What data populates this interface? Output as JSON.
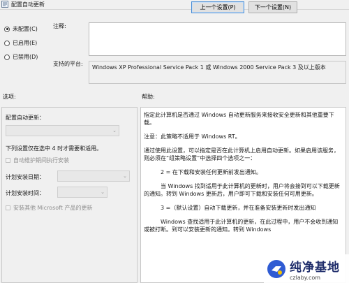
{
  "window": {
    "title": "配置自动更新"
  },
  "nav": {
    "prev": "上一个设置(P)",
    "next": "下一个设置(N)"
  },
  "state": {
    "options": [
      {
        "label": "未配置(C)",
        "checked": true
      },
      {
        "label": "已启用(E)",
        "checked": false
      },
      {
        "label": "已禁用(D)",
        "checked": false
      }
    ]
  },
  "comment": {
    "label": "注释:",
    "value": ""
  },
  "platform": {
    "label": "支持的平台:",
    "value": "Windows XP Professional Service Pack 1 或 Windows 2000 Service Pack 3 及以上版本"
  },
  "options_panel": {
    "heading": "选项:",
    "configure_label": "配置自动更新：",
    "info_text": "下列设置仅在选中 4 时才需要和适用。",
    "maintenance_checkbox": "自动维护期间执行安装",
    "schedule_day_label": "计划安装日期：",
    "schedule_time_label": "计划安装时间：",
    "other_products_checkbox": "安装其他 Microsoft 产品的更新"
  },
  "help_panel": {
    "heading": "帮助:",
    "paragraphs": [
      "指定此计算机是否通过 Windows 自动更新服务来接收安全更新和其他重要下载。",
      "注意：此策略不适用于 Windows RT。",
      "通过使用此设置，可以指定是否在此计算机上启用自动更新。如果启用该服务，则必须在“组策略设置”中选择四个选项之一：",
      "2 = 在下载和安装任何更新前发出通知。",
      "当 Windows 找到适用于此计算机的更新时，用户将会接到可以下载更新的通知。转到 Windows 更新后，用户即可下载和安装任何可用更新。",
      "3 =（默认设置）自动下载更新，并在准备安装更新时发出通知",
      "Windows 查找适用于此计算机的更新，在此过程中，用户不会收到通知或被打断。到可以安装更新的通知。转到 Windows"
    ]
  },
  "watermark": {
    "title": "纯净基地",
    "url": "czlaby.com"
  },
  "colors": {
    "background": "#f0f0f0",
    "accent": "#4a8ed6",
    "watermark": "#1f2d6b"
  }
}
